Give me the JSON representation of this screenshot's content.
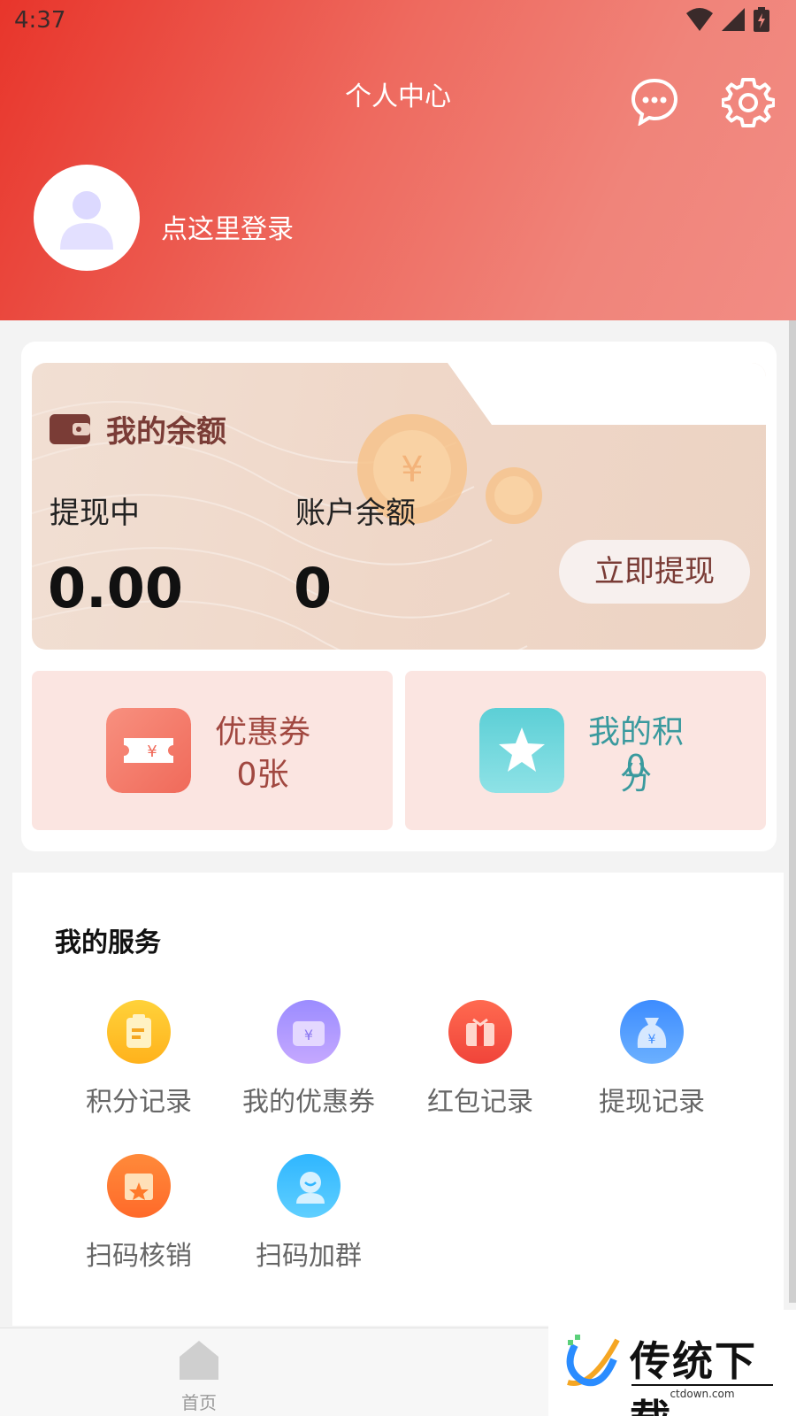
{
  "status_bar": {
    "time": "4:37"
  },
  "header": {
    "title": "个人中心",
    "login_text": "点这里登录"
  },
  "wallet": {
    "title": "我的余额",
    "withdrawing_label": "提现中",
    "withdrawing_value": "0.00",
    "balance_label": "账户余额",
    "balance_value": "0",
    "withdraw_button": "立即提现"
  },
  "coupons": {
    "title": "优惠券",
    "value": "0张"
  },
  "points": {
    "title": "我的积分",
    "value": "0"
  },
  "services": {
    "title": "我的服务",
    "items": [
      {
        "label": "积分记录",
        "icon": "clipboard-icon"
      },
      {
        "label": "我的优惠券",
        "icon": "coupon-icon"
      },
      {
        "label": "红包记录",
        "icon": "gift-icon"
      },
      {
        "label": "提现记录",
        "icon": "moneybag-icon"
      },
      {
        "label": "扫码核销",
        "icon": "ticket-star-icon"
      },
      {
        "label": "扫码加群",
        "icon": "group-icon"
      }
    ]
  },
  "nav": {
    "home_label": "首页"
  },
  "watermark": {
    "text": "传统下载",
    "sub": "ctdown.com"
  }
}
